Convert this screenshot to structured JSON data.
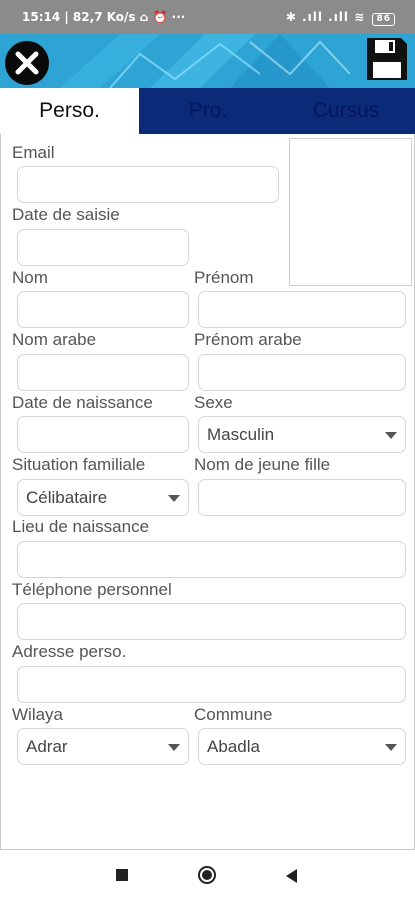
{
  "status_bar": {
    "left": "15:14 | 82,7 Ko/s ⌂ ⏰ ···",
    "right": "✱ .ıll .ıll ≋",
    "battery": "86"
  },
  "header": {
    "close_icon": "close-icon",
    "save_icon": "floppy-disk-icon",
    "accent": "#2fa7d6"
  },
  "tabs": [
    {
      "label": "Perso."
    },
    {
      "label": "Pro."
    },
    {
      "label": "Cursus"
    }
  ],
  "form": {
    "email": {
      "label": "Email",
      "value": ""
    },
    "date_saisie": {
      "label": "Date de saisie",
      "value": ""
    },
    "nom": {
      "label": "Nom",
      "value": ""
    },
    "prenom": {
      "label": "Prénom",
      "value": ""
    },
    "nom_arabe": {
      "label": "Nom arabe",
      "value": ""
    },
    "prenom_arabe": {
      "label": "Prénom arabe",
      "value": ""
    },
    "date_naissance": {
      "label": "Date de naissance",
      "value": ""
    },
    "sexe": {
      "label": "Sexe",
      "value": "Masculin"
    },
    "situation": {
      "label": "Situation familiale",
      "value": "Célibataire"
    },
    "nom_jeune_fille": {
      "label": "Nom de jeune fille",
      "value": ""
    },
    "lieu_naissance": {
      "label": "Lieu de naissance",
      "value": ""
    },
    "telephone": {
      "label": "Téléphone personnel",
      "value": ""
    },
    "adresse": {
      "label": "Adresse perso.",
      "value": ""
    },
    "wilaya": {
      "label": "Wilaya",
      "value": "Adrar"
    },
    "commune": {
      "label": "Commune",
      "value": "Abadla"
    }
  },
  "nav_bar": {
    "recents_icon": "square-icon",
    "home_icon": "circle-icon",
    "back_icon": "triangle-back-icon"
  }
}
